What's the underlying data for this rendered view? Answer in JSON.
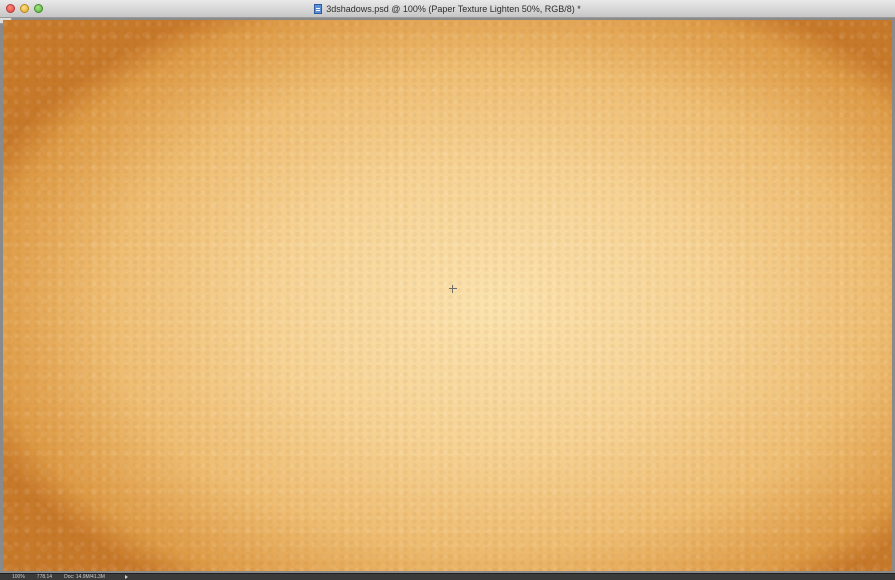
{
  "window": {
    "title": "3dshadows.psd @ 100% (Paper Texture Lighten 50%, RGB/8) *",
    "document_icon": "document-icon"
  },
  "controls": {
    "close": "close-icon",
    "minimize": "minimize-icon",
    "zoom": "zoom-icon"
  },
  "canvas": {
    "cursor_icon": "crosshair-icon",
    "colors": {
      "center": "#fbe2ad",
      "edge": "#c7792a"
    }
  },
  "status": {
    "zoom": "100%",
    "efficiency": "778.14",
    "doc_size": "Doc: 14.9M/41.3M",
    "menu_arrow": "triangle-right-icon"
  }
}
